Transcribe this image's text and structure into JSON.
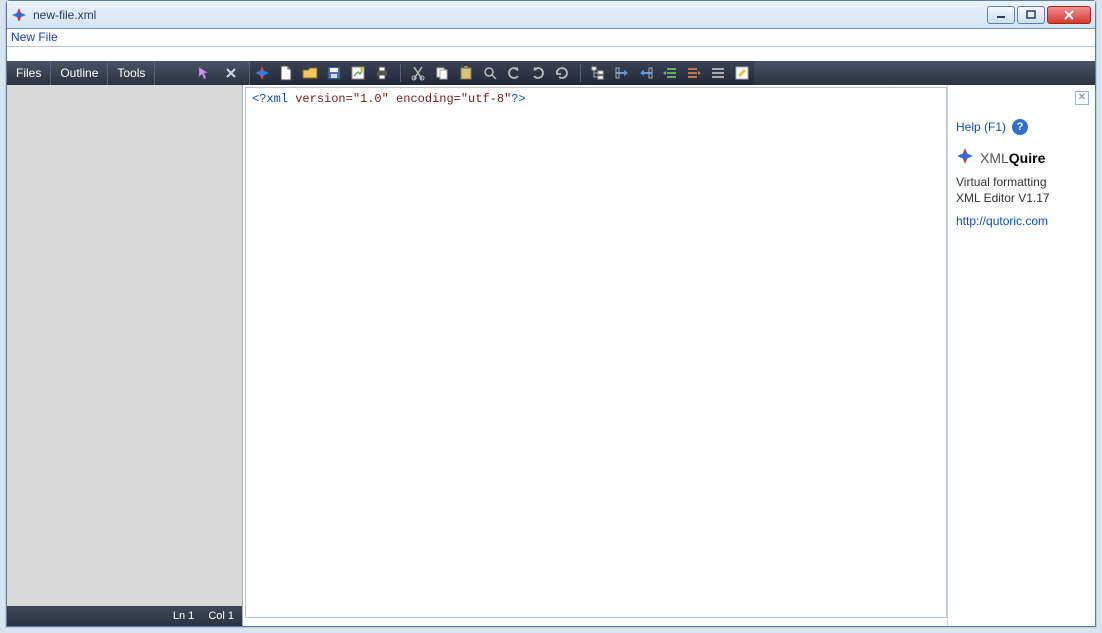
{
  "window": {
    "title": "new-file.xml",
    "subtitle": "New File"
  },
  "menus": {
    "files": "Files",
    "outline": "Outline",
    "tools": "Tools"
  },
  "toolbar": {
    "icons": [
      "app-logo-icon",
      "new-file-icon",
      "open-file-icon",
      "save-icon",
      "save-as-icon",
      "print-icon",
      "cut-icon",
      "copy-icon",
      "paste-icon",
      "find-icon",
      "undo-icon",
      "redo-icon",
      "refresh-icon",
      "tree-icon",
      "collapse-icon",
      "expand-icon",
      "outdent-icon",
      "indent-icon",
      "highlight-icon"
    ]
  },
  "editor": {
    "pi_open": "<?xml",
    "attr1": " version=",
    "val1": "\"1.0\"",
    "attr2": " encoding=",
    "val2": "\"utf-8\"",
    "pi_close": "?>"
  },
  "status": {
    "line": "Ln 1",
    "col": "Col 1"
  },
  "side": {
    "help": "Help (F1)",
    "brand_a": "XML",
    "brand_b": "Quire",
    "desc1": "Virtual formatting",
    "desc2": "XML Editor V1.17",
    "url": "http://qutoric.com"
  }
}
